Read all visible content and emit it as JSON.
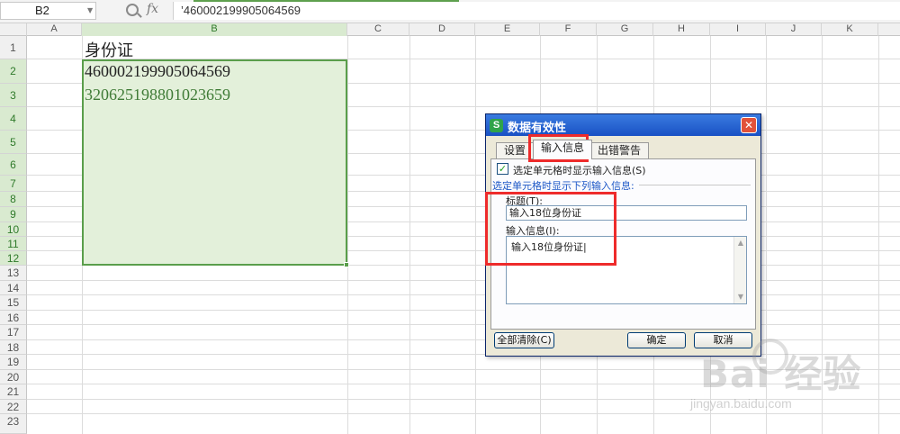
{
  "formula_bar": {
    "name_box": "B2",
    "fx_symbol": "fx",
    "formula": "’460002199905064569"
  },
  "columns": [
    "A",
    "B",
    "C",
    "D",
    "E",
    "F",
    "G",
    "H",
    "I",
    "J",
    "K"
  ],
  "rows": [
    "1",
    "2",
    "3",
    "4",
    "5",
    "6",
    "7",
    "8",
    "9",
    "10",
    "11",
    "12",
    "13",
    "14",
    "15",
    "16",
    "17",
    "18",
    "19",
    "20",
    "21",
    "22",
    "23"
  ],
  "cells": {
    "b1": "身份证",
    "b2": "460002199905064569",
    "b3": "320625198801023659"
  },
  "colors": {
    "selection_fill": "#e3f0da",
    "selection_border": "#5a9e4b",
    "highlight_red": "#ee2b2b",
    "dialog_title": "#1951c4",
    "link_blue": "#1d57c7",
    "cell_b3_text": "#3f7b36"
  },
  "dialog": {
    "title": "数据有效性",
    "logo": "S",
    "close": "✕",
    "tabs": [
      "设置",
      "输入信息",
      "出错警告"
    ],
    "checkbox_label": "选定单元格时显示输入信息(S)",
    "checkbox_checked": "✓",
    "section_label": "选定单元格时显示下列输入信息:",
    "title_label": "标题(T):",
    "title_value": "输入18位身份证",
    "message_label": "输入信息(I):",
    "message_value": "输入18位身份证|",
    "clear_all_button": "全部清除(C)",
    "ok_button": "确定",
    "cancel_button": "取消"
  },
  "watermark": {
    "brand": "Bai  经验",
    "url": "jingyan.baidu.com"
  }
}
